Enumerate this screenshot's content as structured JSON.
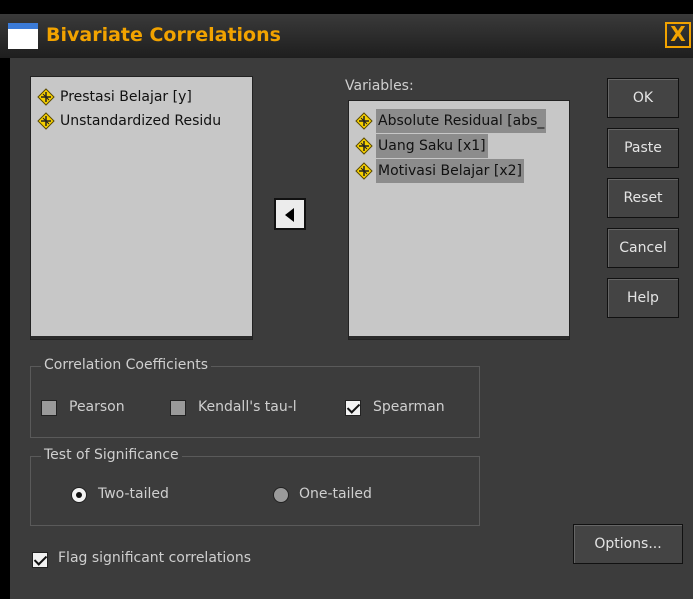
{
  "window": {
    "title": "Bivariate Correlations",
    "close_glyph": "X"
  },
  "source_list": {
    "items": [
      {
        "label": "Prestasi Belajar [y]",
        "icon": "scale-variable-icon"
      },
      {
        "label": "Unstandardized Residu",
        "icon": "scale-variable-icon"
      }
    ]
  },
  "move_button": {
    "icon": "arrow-left-icon"
  },
  "variables": {
    "label": "Variables:",
    "items": [
      {
        "label": "Absolute Residual [abs_",
        "icon": "scale-variable-icon",
        "selected": true
      },
      {
        "label": "Uang Saku [x1]",
        "icon": "scale-variable-icon",
        "selected": true
      },
      {
        "label": "Motivasi Belajar [x2]",
        "icon": "scale-variable-icon",
        "selected": true
      }
    ]
  },
  "buttons": {
    "ok": "OK",
    "paste": "Paste",
    "reset": "Reset",
    "cancel": "Cancel",
    "help": "Help",
    "options": "Options..."
  },
  "correlation_coefficients": {
    "title": "Correlation Coefficients",
    "pearson": {
      "label": "Pearson",
      "checked": false
    },
    "kendall": {
      "label": "Kendall's tau-l",
      "checked": false
    },
    "spearman": {
      "label": "Spearman",
      "checked": true
    }
  },
  "test_of_significance": {
    "title": "Test of Significance",
    "two_tailed": {
      "label": "Two-tailed",
      "selected": true
    },
    "one_tailed": {
      "label": "One-tailed",
      "selected": false
    }
  },
  "flag_significant": {
    "label": "Flag significant correlations",
    "checked": true
  },
  "colors": {
    "title_text": "#f2a300",
    "dialog_bg": "#3c3c3c",
    "list_bg": "#c7c7c7",
    "selection": "#8c8c8c"
  }
}
